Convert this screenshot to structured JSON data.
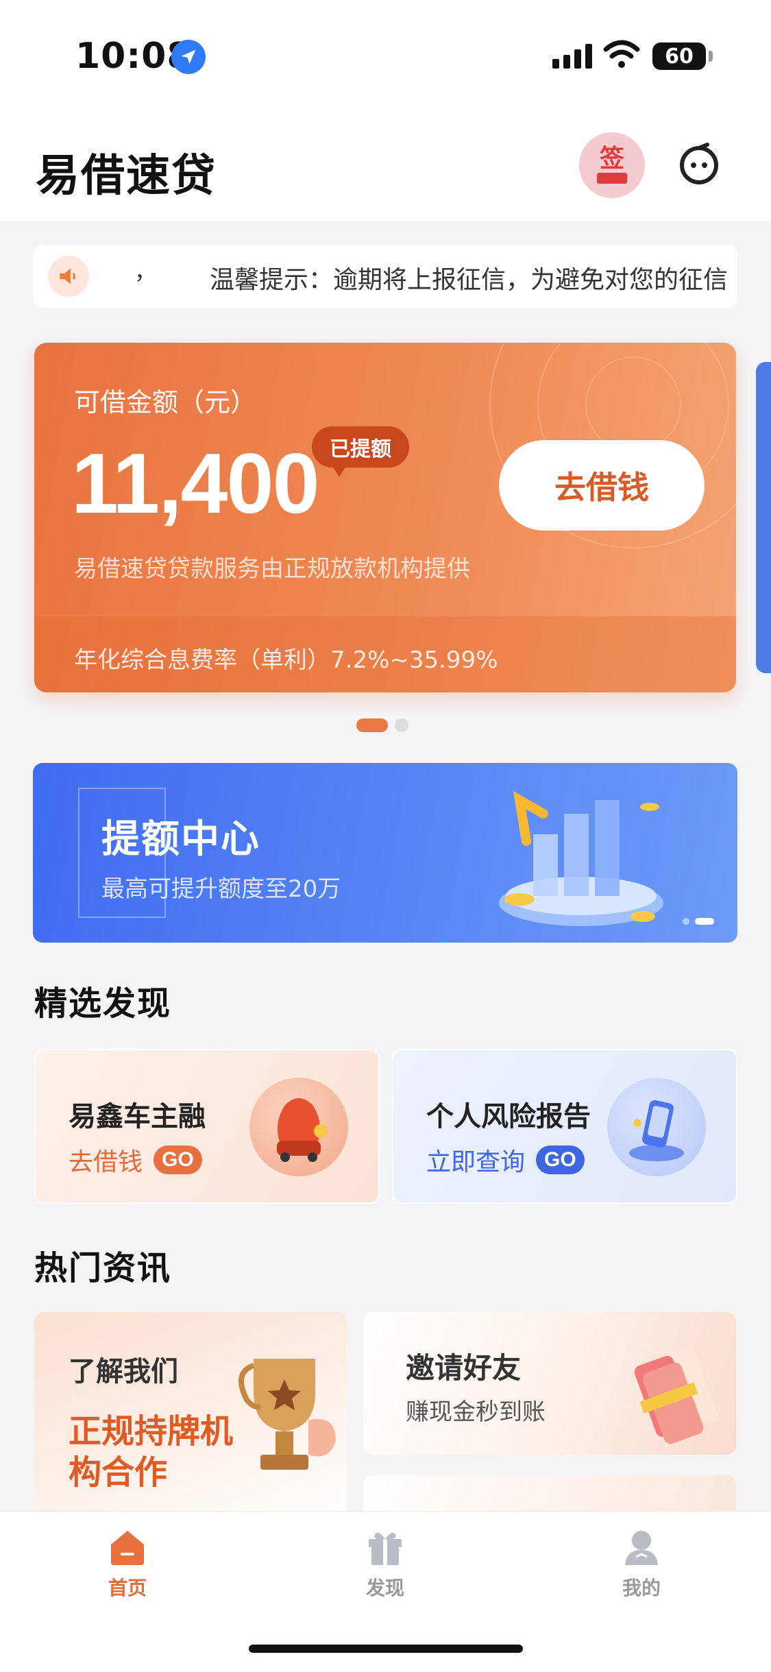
{
  "status_bar": {
    "time": "10:08",
    "battery": "60"
  },
  "header": {
    "app_title": "易借速贷",
    "sign_label": "签"
  },
  "notice": {
    "prefix": "，",
    "text": "温馨提示：逾期将上报征信，为避免对您的征信"
  },
  "loan_card": {
    "label": "可借金额（元）",
    "amount": "11,400",
    "badge": "已提额",
    "button": "去借钱",
    "description": "易借速贷贷款服务由正规放款机构提供",
    "rate": "年化综合息费率（单利）7.2%~35.99%"
  },
  "quota_banner": {
    "title": "提额中心",
    "subtitle": "最高可提升额度至20万"
  },
  "featured": {
    "title": "精选发现",
    "cards": [
      {
        "title": "易鑫车主融",
        "link": "去借钱",
        "go": "GO"
      },
      {
        "title": "个人风险报告",
        "link": "立即查询",
        "go": "GO"
      }
    ]
  },
  "news": {
    "title": "热门资讯",
    "about": {
      "title": "了解我们",
      "highlight": "正规持牌机构合作"
    },
    "invite": {
      "title": "邀请好友",
      "subtitle": "赚现金秒到账"
    }
  },
  "tabbar": {
    "items": [
      {
        "label": "首页",
        "icon": "home-icon",
        "active": true
      },
      {
        "label": "发现",
        "icon": "gift-icon",
        "active": false
      },
      {
        "label": "我的",
        "icon": "user-icon",
        "active": false
      }
    ]
  },
  "colors": {
    "accent": "#e8703f",
    "blue": "#3e66e3"
  }
}
